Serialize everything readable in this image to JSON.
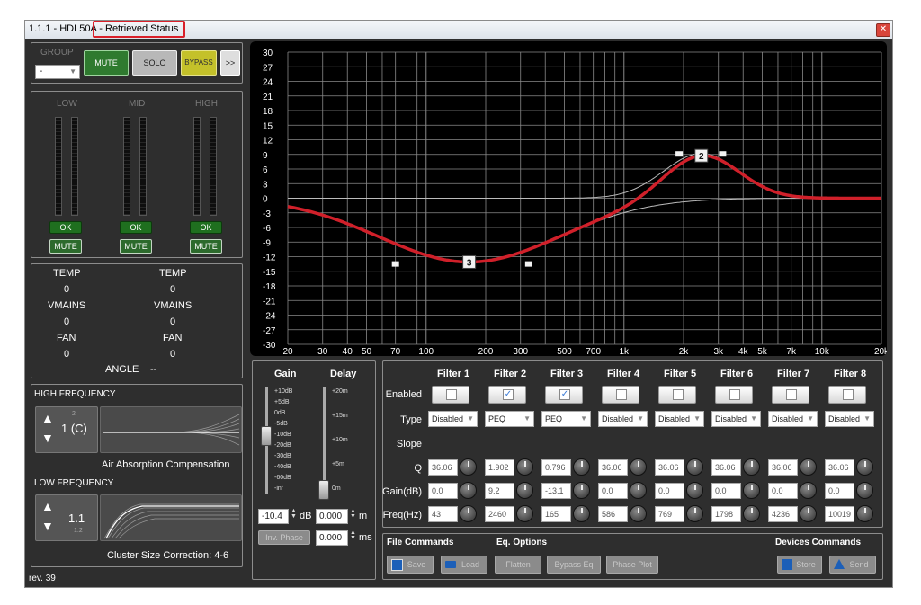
{
  "window": {
    "title_prefix": "1.1.1 - HDL50A - ",
    "title_status": "Retrieved Status",
    "close_label": "✕"
  },
  "group": {
    "label": "GROUP",
    "value": "-",
    "mute": "MUTE",
    "solo": "SOLO",
    "bypass": "BYPASS",
    "more": ">>"
  },
  "bands": [
    {
      "name": "LOW",
      "ok": "OK",
      "mute": "MUTE"
    },
    {
      "name": "MID",
      "ok": "OK",
      "mute": "MUTE"
    },
    {
      "name": "HIGH",
      "ok": "OK",
      "mute": "MUTE"
    }
  ],
  "status": {
    "col1": {
      "temp_label": "TEMP",
      "temp": "0",
      "vmains_label": "VMAINS",
      "vmains": "0",
      "fan_label": "FAN",
      "fan": "0"
    },
    "col2": {
      "temp_label": "TEMP",
      "temp": "0",
      "vmains_label": "VMAINS",
      "vmains": "0",
      "fan_label": "FAN",
      "fan": "0"
    },
    "angle_label": "ANGLE",
    "angle": "--"
  },
  "high_frequency": {
    "title": "HIGH FREQUENCY",
    "small_value": "2",
    "value": "1 (C)",
    "caption": "Air Absorption Compensation"
  },
  "low_frequency": {
    "title": "LOW FREQUENCY",
    "value": "1.1",
    "small_value": "1.2",
    "caption": "Cluster Size Correction:  4-6"
  },
  "revision": "rev. 39",
  "eq_plot": {
    "y_ticks": [
      "30",
      "27",
      "24",
      "21",
      "18",
      "15",
      "12",
      "9",
      "6",
      "3",
      "0",
      "-3",
      "-6",
      "-9",
      "-12",
      "-15",
      "-18",
      "-21",
      "-24",
      "-27",
      "-30"
    ],
    "x_ticks": [
      "20",
      "30",
      "40",
      "50",
      "70",
      "100",
      "200",
      "300",
      "500",
      "700",
      "1k",
      "2k",
      "3k",
      "4k",
      "5k",
      "7k",
      "10k",
      "20k"
    ],
    "markers": [
      "3",
      "2"
    ],
    "accent": "#d0202a"
  },
  "gain_delay": {
    "gain_label": "Gain",
    "delay_label": "Delay",
    "gain_scale": [
      "+10dB",
      "+5dB",
      "0dB",
      "-5dB",
      "-10dB",
      "-20dB",
      "-30dB",
      "-40dB",
      "-60dB",
      "-inf"
    ],
    "delay_scale": [
      "+20m",
      "+15m",
      "+10m",
      "+5m",
      "0m"
    ],
    "gain_value": "-10.4",
    "gain_unit": "dB",
    "delay_m_value": "0.000",
    "delay_m_unit": "m",
    "delay_ms_value": "0.000",
    "delay_ms_unit": "ms",
    "inv_phase": "Inv. Phase"
  },
  "filters": {
    "row_labels": {
      "enabled": "Enabled",
      "type": "Type",
      "slope": "Slope",
      "q": "Q",
      "gain": "Gain(dB)",
      "freq": "Freq(Hz)"
    },
    "items": [
      {
        "name": "Filter 1",
        "enabled": false,
        "type": "Disabled",
        "q": "36.06",
        "gain": "0.0",
        "freq": "43"
      },
      {
        "name": "Filter 2",
        "enabled": true,
        "type": "PEQ",
        "q": "1.902",
        "gain": "9.2",
        "freq": "2460"
      },
      {
        "name": "Filter 3",
        "enabled": true,
        "type": "PEQ",
        "q": "0.796",
        "gain": "-13.1",
        "freq": "165"
      },
      {
        "name": "Filter 4",
        "enabled": false,
        "type": "Disabled",
        "q": "36.06",
        "gain": "0.0",
        "freq": "586"
      },
      {
        "name": "Filter 5",
        "enabled": false,
        "type": "Disabled",
        "q": "36.06",
        "gain": "0.0",
        "freq": "769"
      },
      {
        "name": "Filter 6",
        "enabled": false,
        "type": "Disabled",
        "q": "36.06",
        "gain": "0.0",
        "freq": "1798"
      },
      {
        "name": "Filter 7",
        "enabled": false,
        "type": "Disabled",
        "q": "36.06",
        "gain": "0.0",
        "freq": "4236"
      },
      {
        "name": "Filter 8",
        "enabled": false,
        "type": "Disabled",
        "q": "36.06",
        "gain": "0.0",
        "freq": "10019"
      }
    ]
  },
  "commands": {
    "file_title": "File Commands",
    "eq_title": "Eq. Options",
    "devices_title": "Devices Commands",
    "save": "Save",
    "load": "Load",
    "flatten": "Flatten",
    "bypass_eq": "Bypass Eq",
    "phase_plot": "Phase Plot",
    "store": "Store",
    "send": "Send"
  }
}
